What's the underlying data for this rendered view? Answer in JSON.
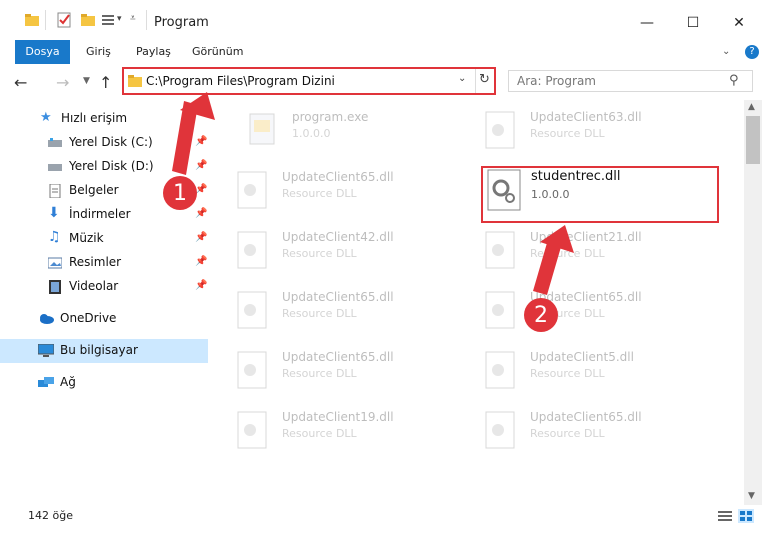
{
  "window": {
    "title": "Program"
  },
  "ribbon": {
    "tabs": [
      "Dosya",
      "Giriş",
      "Paylaş",
      "Görünüm"
    ]
  },
  "address": {
    "path": "C:\\Program Files\\Program Dizini"
  },
  "search": {
    "placeholder": "Ara: Program"
  },
  "sidebar": {
    "items": [
      {
        "label": "Hızlı erişim",
        "icon": "star-icon",
        "pinned": false
      },
      {
        "label": "Yerel Disk (C:)",
        "icon": "drive-icon",
        "pinned": true
      },
      {
        "label": "Yerel Disk (D:)",
        "icon": "drive-icon",
        "pinned": true
      },
      {
        "label": "Belgeler",
        "icon": "documents-icon",
        "pinned": true
      },
      {
        "label": "İndirmeler",
        "icon": "download-icon",
        "pinned": true
      },
      {
        "label": "Müzik",
        "icon": "music-icon",
        "pinned": true
      },
      {
        "label": "Resimler",
        "icon": "pictures-icon",
        "pinned": true
      },
      {
        "label": "Videolar",
        "icon": "video-icon",
        "pinned": true
      },
      {
        "label": "OneDrive",
        "icon": "cloud-icon",
        "pinned": false
      },
      {
        "label": "Bu bilgisayar",
        "icon": "computer-icon",
        "pinned": false,
        "selected": true
      },
      {
        "label": "Ağ",
        "icon": "network-icon",
        "pinned": false
      }
    ]
  },
  "files": [
    {
      "name": "program.exe",
      "type": "1.0.0.0"
    },
    {
      "name": "UpdateClient63.dll",
      "type": "Resource DLL"
    },
    {
      "name": "UpdateClient65.dll",
      "type": "Resource DLL"
    },
    {
      "name": "UpdateClient42.dll",
      "type": "Resource DLL"
    },
    {
      "name": "UpdateClient21.dll",
      "type": "Resource DLL"
    },
    {
      "name": "UpdateClient65.dll",
      "type": "Resource DLL"
    },
    {
      "name": "UpdateClient65.dll",
      "type": "Resource DLL"
    },
    {
      "name": "UpdateClient65.dll",
      "type": "Resource DLL"
    },
    {
      "name": "UpdateClient5.dll",
      "type": "Resource DLL"
    },
    {
      "name": "UpdateClient19.dll",
      "type": "Resource DLL"
    },
    {
      "name": "UpdateClient65.dll",
      "type": "Resource DLL"
    }
  ],
  "highlighted_file": {
    "name": "studentrec.dll",
    "type": "1.0.0.0"
  },
  "status": {
    "item_count": "142 öğe"
  },
  "annotations": {
    "step1": "1",
    "step2": "2",
    "color": "#e0343a"
  }
}
